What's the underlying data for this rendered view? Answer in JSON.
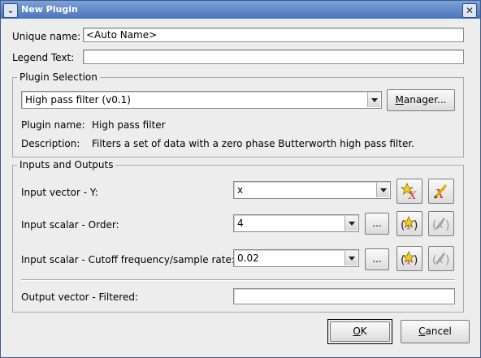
{
  "window": {
    "title": "New Plugin",
    "menu_glyph": "⌄",
    "close_glyph": "✕"
  },
  "form": {
    "unique_name_label": "Unique name:",
    "unique_name_value": "<Auto Name>",
    "legend_text_label": "Legend Text:",
    "legend_text_value": ""
  },
  "plugin_selection": {
    "group_title": "Plugin Selection",
    "selected_plugin": "High pass filter (v0.1)",
    "manager_button": {
      "prefix": "",
      "mnemonic": "M",
      "suffix": "anager..."
    },
    "plugin_name_label": "Plugin name:",
    "plugin_name_value": "High pass filter",
    "description_label": "Description:",
    "description_value": "Filters a set of data with a zero phase Butterworth high pass filter."
  },
  "io": {
    "group_title": "Inputs and Outputs",
    "input_vector_label": "Input vector - Y:",
    "input_vector_value": "x",
    "order_label": "Input scalar - Order:",
    "order_value": "4",
    "cutoff_label": "Input scalar - Cutoff frequency/sample rate:",
    "cutoff_value": "0.02",
    "ellipsis_label": "...",
    "output_vector_label": "Output vector - Filtered:",
    "output_vector_value": ""
  },
  "buttons": {
    "ok": {
      "mnemonic": "O",
      "suffix": "K"
    },
    "cancel": {
      "mnemonic": "C",
      "suffix": "ancel"
    }
  },
  "icons": {
    "new_vector": "new-vector-icon",
    "edit_vector": "edit-vector-icon",
    "new_scalar": "new-scalar-icon",
    "edit_scalar": "edit-scalar-icon"
  },
  "colors": {
    "titlebar_top": "#7ea2d8",
    "titlebar_bottom": "#4a73b9",
    "star": "#f2d21b",
    "x_red": "#c0392b"
  }
}
